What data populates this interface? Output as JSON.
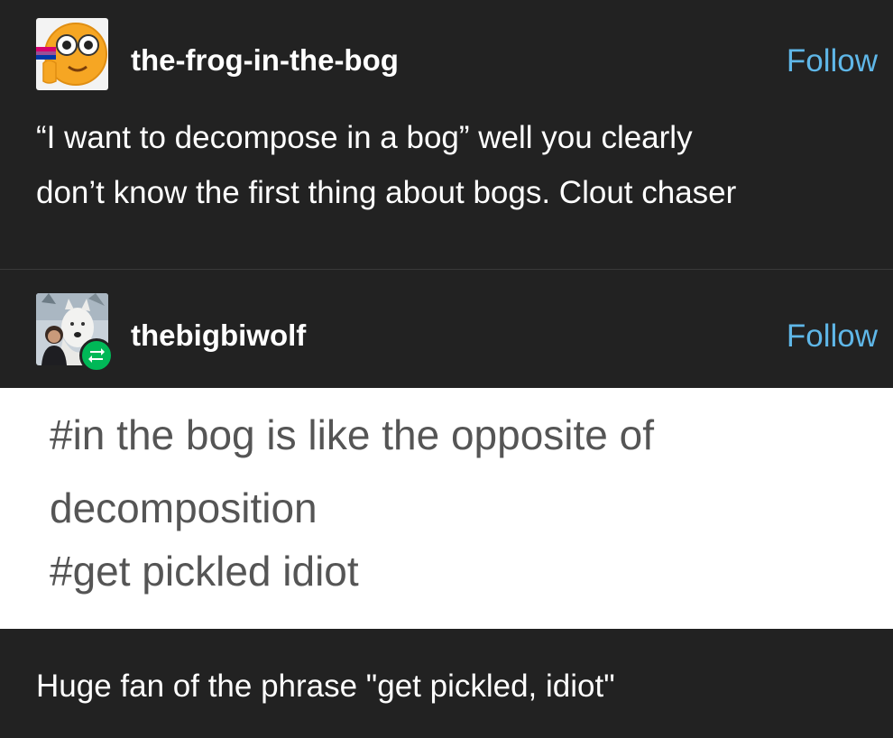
{
  "posts": [
    {
      "username": "the-frog-in-the-bog",
      "follow_label": "Follow",
      "body_lines": [
        "“I want to decompose in a bog” well you clearly",
        "don’t know the first thing about bogs. Clout chaser"
      ],
      "avatar_icon": "frog-emoji-icon"
    },
    {
      "username": "thebigbiwolf",
      "follow_label": "Follow",
      "avatar_icon": "person-with-wolf-photo",
      "badge_icon": "reblog-icon",
      "tags": [
        "#in the bog is like the opposite of",
        "decomposition",
        "#get pickled idiot"
      ],
      "comment": "Huge fan of the phrase \"get pickled, idiot\""
    }
  ],
  "colors": {
    "background": "#222222",
    "follow_link": "#5fb7e8",
    "tag_text": "#555555",
    "tag_background": "#ffffff",
    "reblog_badge": "#00b857"
  }
}
